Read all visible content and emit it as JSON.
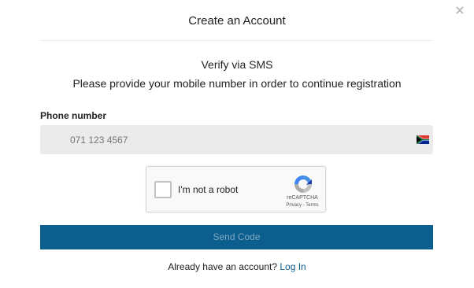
{
  "modal": {
    "title": "Create an Account",
    "close_glyph": "×"
  },
  "verify": {
    "title": "Verify via SMS",
    "description": "Please provide your mobile number in order to continue registration"
  },
  "phone": {
    "label": "Phone number",
    "placeholder": "071 123 4567",
    "value": "",
    "country_flag": "south-africa-flag-icon"
  },
  "recaptcha": {
    "label": "I'm not a robot",
    "brand": "reCAPTCHA",
    "links": "Privacy - Terms",
    "checked": false
  },
  "actions": {
    "send_label": "Send Code"
  },
  "footer": {
    "prompt": "Already have an account?",
    "login_label": "Log In"
  },
  "colors": {
    "primary": "#0b5e8d",
    "input_bg": "#ebebeb",
    "button_text_disabled": "#7fa9c4"
  }
}
